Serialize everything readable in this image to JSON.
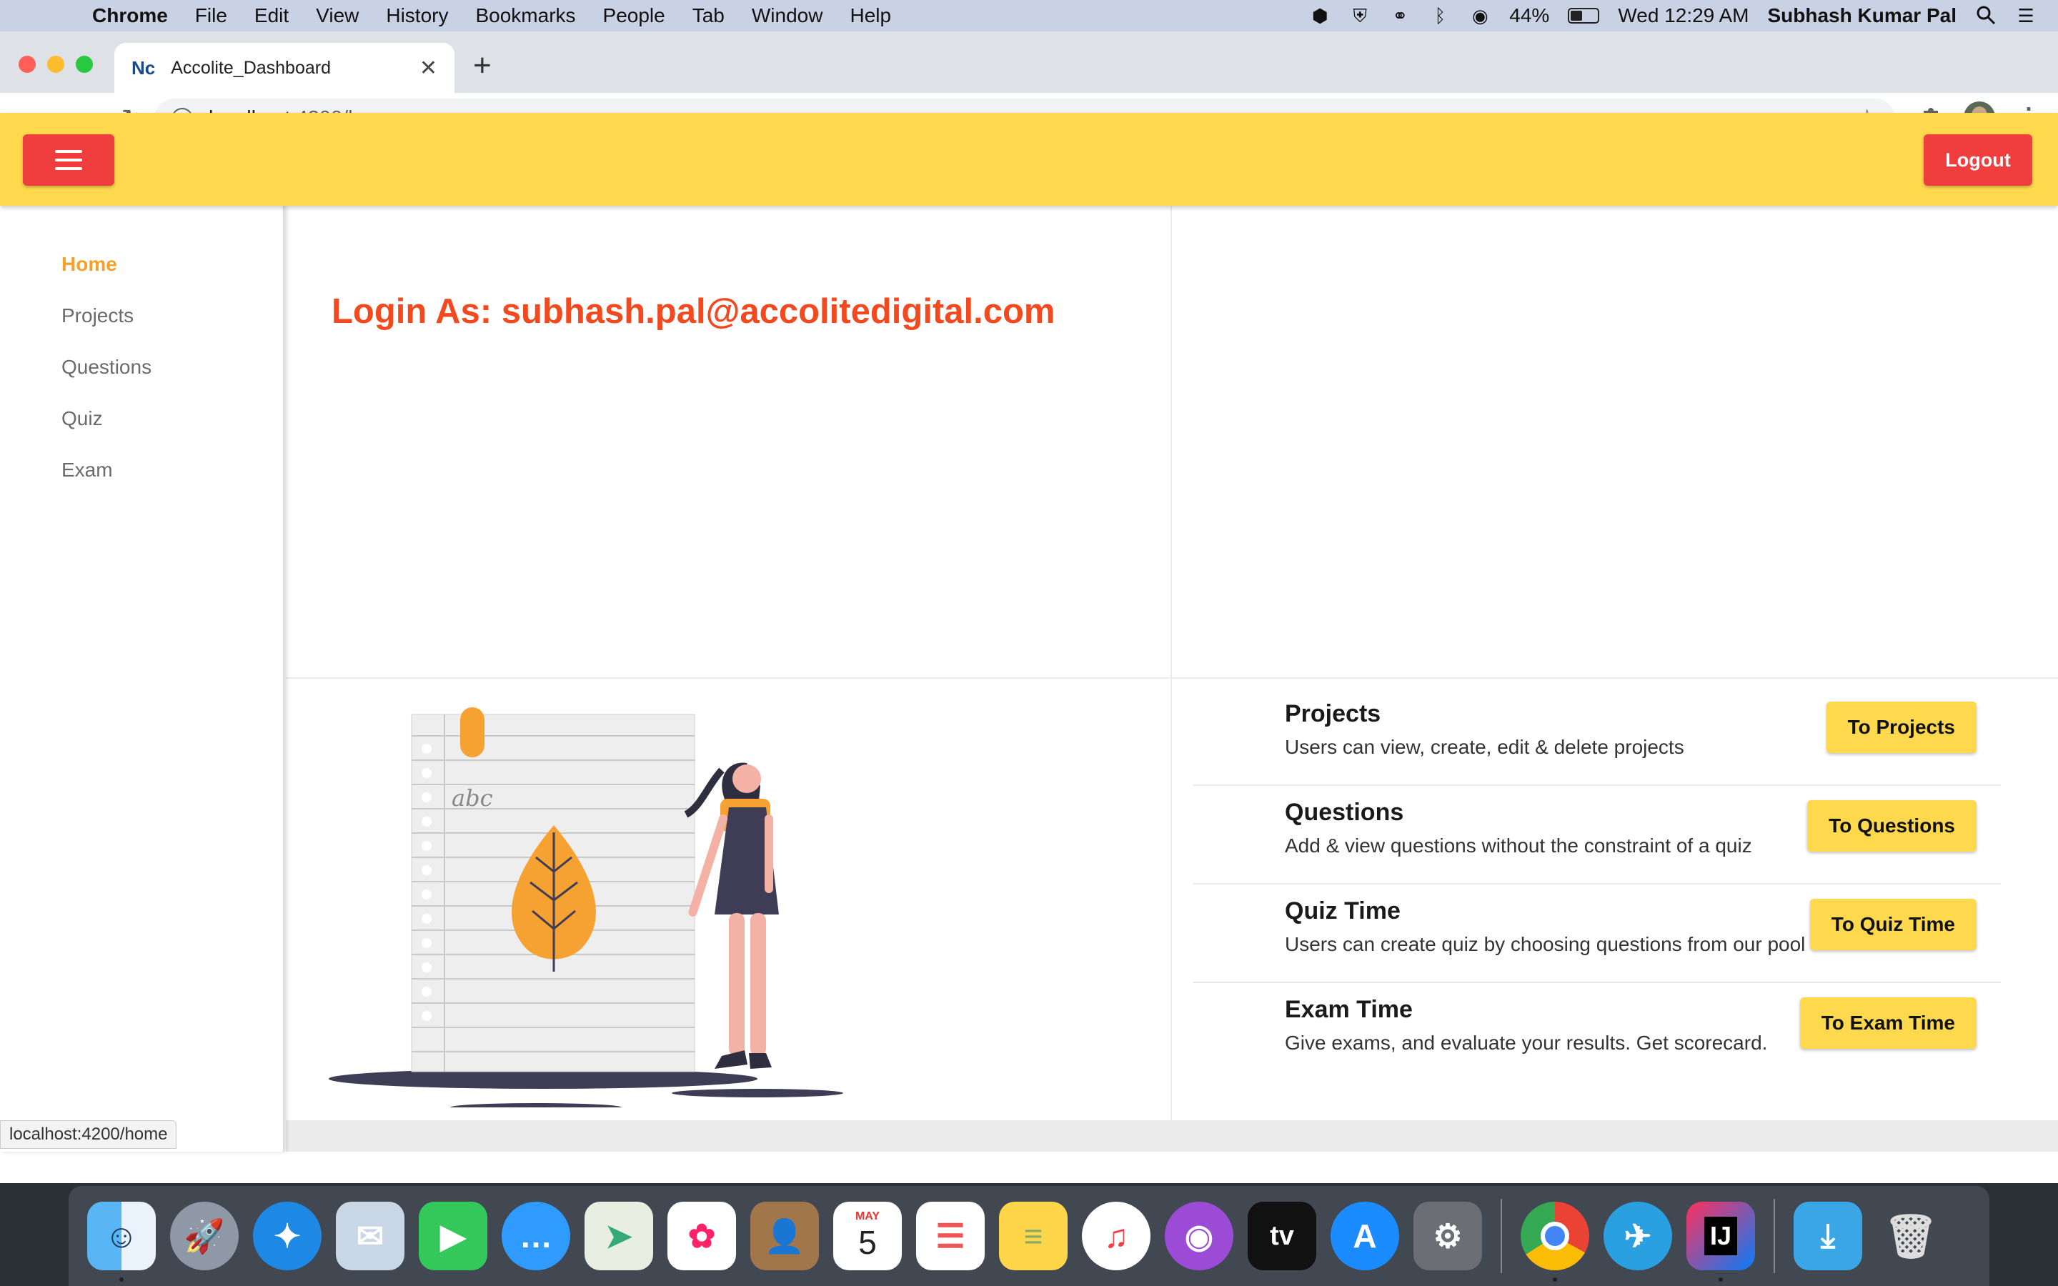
{
  "menubar": {
    "app": "Chrome",
    "items": [
      "File",
      "Edit",
      "View",
      "History",
      "Bookmarks",
      "People",
      "Tab",
      "Window",
      "Help"
    ],
    "battery": "44%",
    "battery_level": 0.44,
    "clock": "Wed 12:29 AM",
    "user": "Subhash Kumar Pal"
  },
  "browser": {
    "tab_title": "Accolite_Dashboard",
    "tab_favicon": "Nc",
    "url_host": "localhost",
    "url_path": ":4200/home",
    "status_url": "localhost:4200/home"
  },
  "header": {
    "logout_label": "Logout"
  },
  "sidebar": {
    "items": [
      {
        "label": "Home",
        "active": true
      },
      {
        "label": "Projects",
        "active": false
      },
      {
        "label": "Questions",
        "active": false
      },
      {
        "label": "Quiz",
        "active": false
      },
      {
        "label": "Exam",
        "active": false
      }
    ]
  },
  "main": {
    "login_as": "Login As: subhash.pal@accolitedigital.com",
    "illustration_text": "abc",
    "features": [
      {
        "title": "Projects",
        "desc": "Users can view, create, edit & delete projects",
        "button": "To Projects"
      },
      {
        "title": "Questions",
        "desc": "Add & view questions without the constraint of a quiz",
        "button": "To Questions"
      },
      {
        "title": "Quiz Time",
        "desc": "Users can create quiz by choosing questions from our pool",
        "button": "To Quiz Time"
      },
      {
        "title": "Exam Time",
        "desc": "Give exams, and evaluate your results. Get scorecard.",
        "button": "To Exam Time"
      }
    ]
  },
  "dock": {
    "calendar_month": "MAY",
    "calendar_day": "5",
    "tv_label": "tv",
    "intellij_label": "IJ"
  },
  "colors": {
    "appbar": "#fed84d",
    "accent_red": "#f03e3e",
    "login_text": "#f2491f",
    "sidebar_active": "#f6a02c"
  }
}
